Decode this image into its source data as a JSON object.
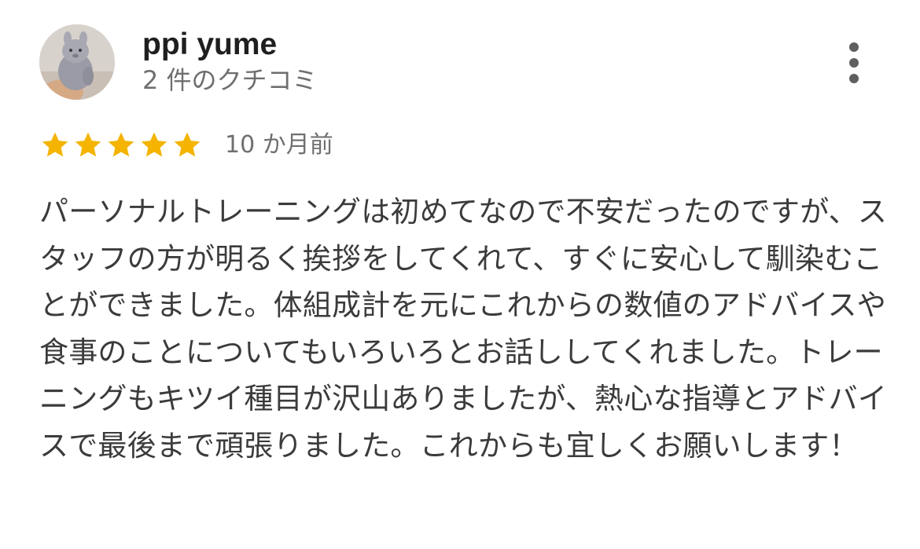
{
  "reviewer": {
    "name": "ppi yume",
    "review_count": "2 件のクチコミ",
    "avatar_icon": "avatar-photo"
  },
  "menu": {
    "icon": "more-vert-icon"
  },
  "rating": {
    "stars": 5,
    "max_stars": 5,
    "star_color": "#f4b400",
    "date": "10 か月前"
  },
  "review": {
    "text": "パーソナルトレーニングは初めてなので不安だったのですが、スタッフの方が明るく挨拶をしてくれて、すぐに安心して馴染むことができました。体組成計を元にこれからの数値のアドバイスや食事のことについてもいろいろとお話ししてくれました。トレーニングもキツイ種目が沢山ありましたが、熱心な指導とアドバイスで最後まで頑張りました。これからも宜しくお願いします！"
  }
}
